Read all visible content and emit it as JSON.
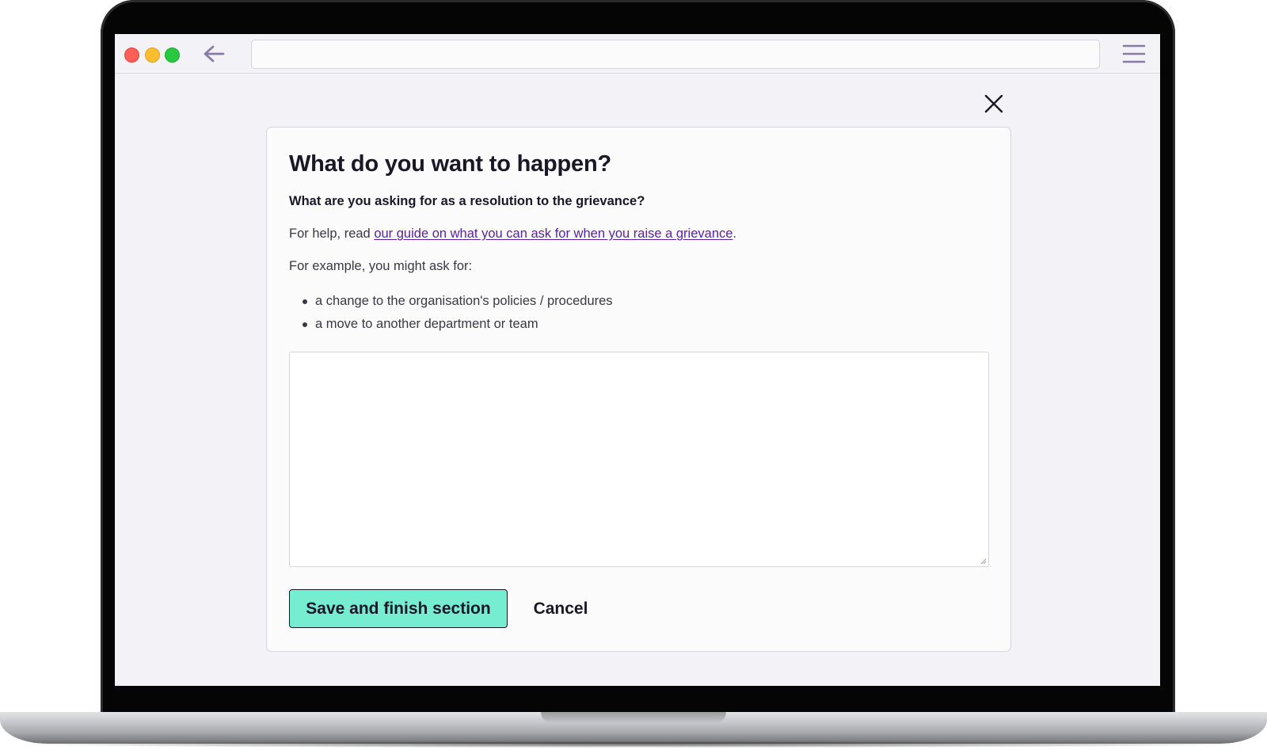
{
  "browser": {
    "url_value": "",
    "controls": {
      "close_color": "#fe5f57",
      "minimize_color": "#febc2e",
      "maximize_color": "#28c840"
    },
    "back_icon": "arrow-left-icon",
    "menu_icon": "hamburger-menu-icon"
  },
  "page": {
    "close_icon": "close-x-icon",
    "title": "What do you want to happen?",
    "question": "What are you asking for as a resolution to the grievance?",
    "help_prefix": "For help, read ",
    "help_link": "our guide on what you can ask for when you raise a grievance",
    "help_suffix": ".",
    "example_intro": "For example, you might ask for:",
    "examples": [
      "a change to the organisation's policies / procedures",
      "a move to another department or team"
    ],
    "answer_value": "",
    "save_label": "Save and finish section",
    "cancel_label": "Cancel",
    "colors": {
      "primary_button": "#76ecd1",
      "link": "#5b1f9e",
      "text": "#1a1727",
      "background": "#f3f2f6"
    }
  }
}
